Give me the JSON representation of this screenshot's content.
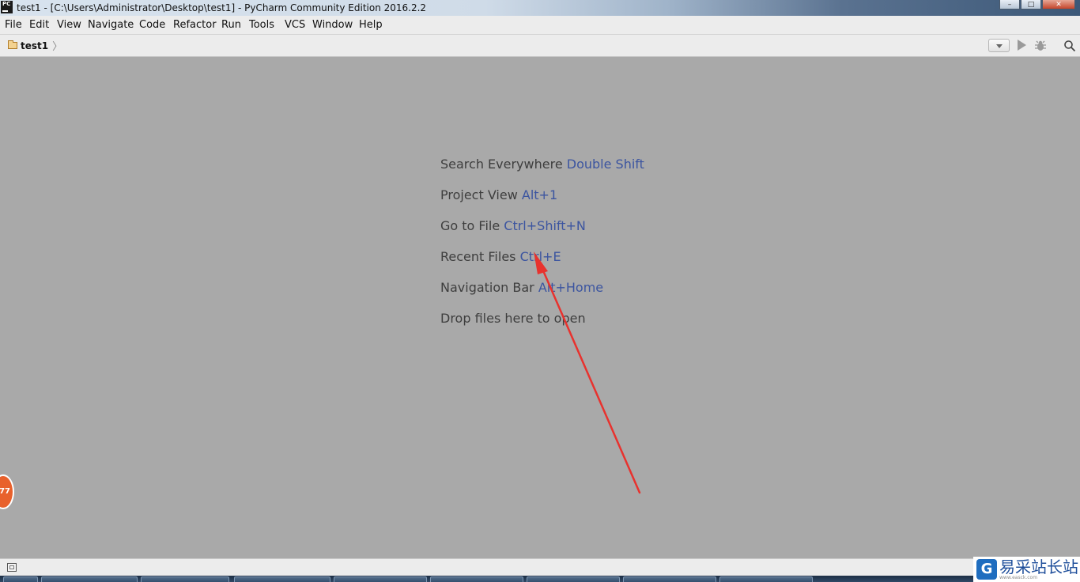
{
  "window": {
    "title": "test1 - [C:\\Users\\Administrator\\Desktop\\test1] - PyCharm Community Edition 2016.2.2",
    "app_icon_text": "PC",
    "buttons": {
      "minimize": "–",
      "maximize": "□",
      "close": "✕"
    }
  },
  "menu": {
    "items": [
      "File",
      "Edit",
      "View",
      "Navigate",
      "Code",
      "Refactor",
      "Run",
      "Tools",
      "VCS",
      "Window",
      "Help"
    ]
  },
  "navbar": {
    "breadcrumb": "test1",
    "separator": "〉"
  },
  "editor": {
    "hints": [
      {
        "text": "Search Everywhere ",
        "shortcut": "Double Shift"
      },
      {
        "text": "Project View ",
        "shortcut": "Alt+1"
      },
      {
        "text": "Go to File ",
        "shortcut": "Ctrl+Shift+N"
      },
      {
        "text": "Recent Files ",
        "shortcut": "Ctrl+E"
      },
      {
        "text": "Navigation Bar ",
        "shortcut": "Alt+Home"
      },
      {
        "text": "Drop files here to open",
        "shortcut": ""
      }
    ],
    "annotation_arrow_color": "#e8322e",
    "hint_key_color": "#3c55a0"
  },
  "badge": {
    "value": "77"
  },
  "watermark": {
    "logo": "G",
    "text": "易采站长站",
    "subtext": "www.easck.com"
  },
  "colors": {
    "editor_bg": "#a9a9a9",
    "menubar_bg": "#ececec"
  }
}
